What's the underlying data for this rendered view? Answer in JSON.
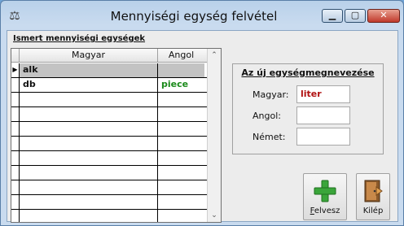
{
  "window": {
    "title": "Mennyiségi egység felvétel",
    "app_icon": "scales-icon"
  },
  "list_section": {
    "label": "Ismert mennyiségi egységek"
  },
  "grid": {
    "columns": [
      "Magyar",
      "Angol"
    ],
    "rows": [
      {
        "magyar": "alk",
        "angol": ""
      },
      {
        "magyar": "db",
        "angol": "piece"
      },
      {
        "magyar": "",
        "angol": ""
      },
      {
        "magyar": "",
        "angol": ""
      },
      {
        "magyar": "",
        "angol": ""
      },
      {
        "magyar": "",
        "angol": ""
      },
      {
        "magyar": "",
        "angol": ""
      },
      {
        "magyar": "",
        "angol": ""
      },
      {
        "magyar": "",
        "angol": ""
      },
      {
        "magyar": "",
        "angol": ""
      },
      {
        "magyar": "",
        "angol": ""
      }
    ],
    "selected_row": 0
  },
  "new_unit_form": {
    "title": "Az új egységmegnevezése",
    "fields": [
      {
        "label": "Magyar:",
        "value": "liter"
      },
      {
        "label": "Angol:",
        "value": ""
      },
      {
        "label": "Német:",
        "value": ""
      }
    ]
  },
  "buttons": {
    "add": {
      "label": "Felvesz",
      "accel": "F",
      "rest": "elvesz",
      "icon": "plus-icon",
      "color": "#3aa53a"
    },
    "exit": {
      "label": "Kilép",
      "icon": "door-exit-icon"
    }
  },
  "colors": {
    "english_text": "#1a8a1a",
    "input_text": "#b01010"
  }
}
